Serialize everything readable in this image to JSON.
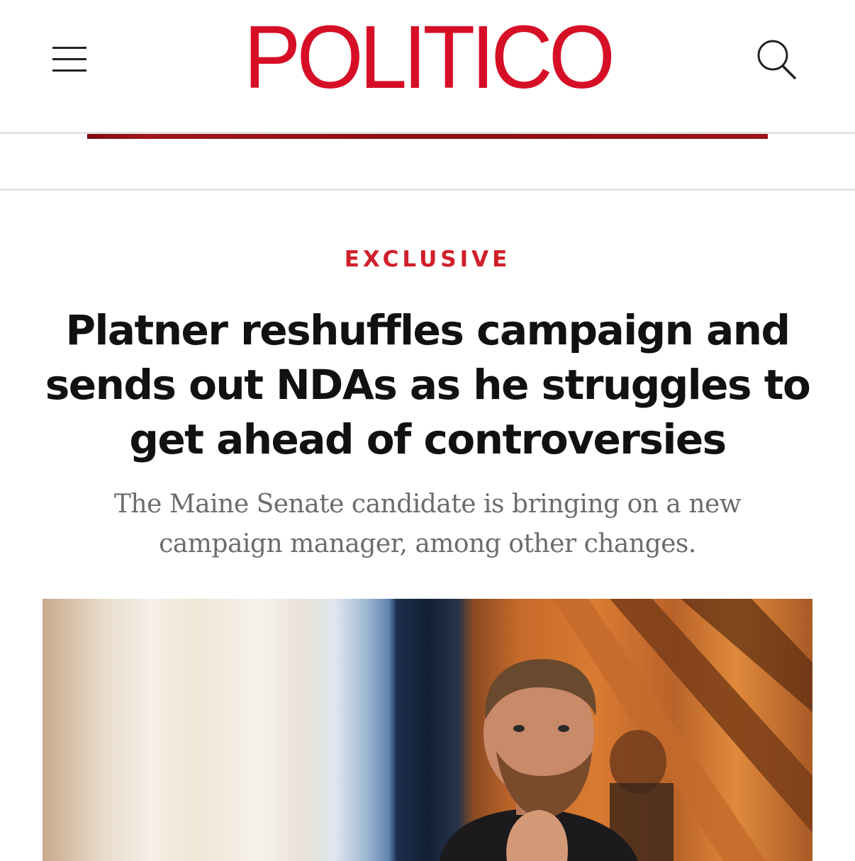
{
  "header": {
    "logo_text": "POLITICO",
    "menu_icon": "hamburger-menu-icon",
    "search_icon": "search-icon",
    "brand_color": "#d60f26"
  },
  "article": {
    "kicker": "EXCLUSIVE",
    "headline_lines": [
      "Platner reshuffles campaign and",
      "sends out NDAs as he struggles to",
      "get ahead of controversies"
    ],
    "dek_lines": [
      "The Maine Senate candidate is bringing on a new",
      "campaign manager, among other changes."
    ],
    "kicker_color": "#d01f2a"
  }
}
